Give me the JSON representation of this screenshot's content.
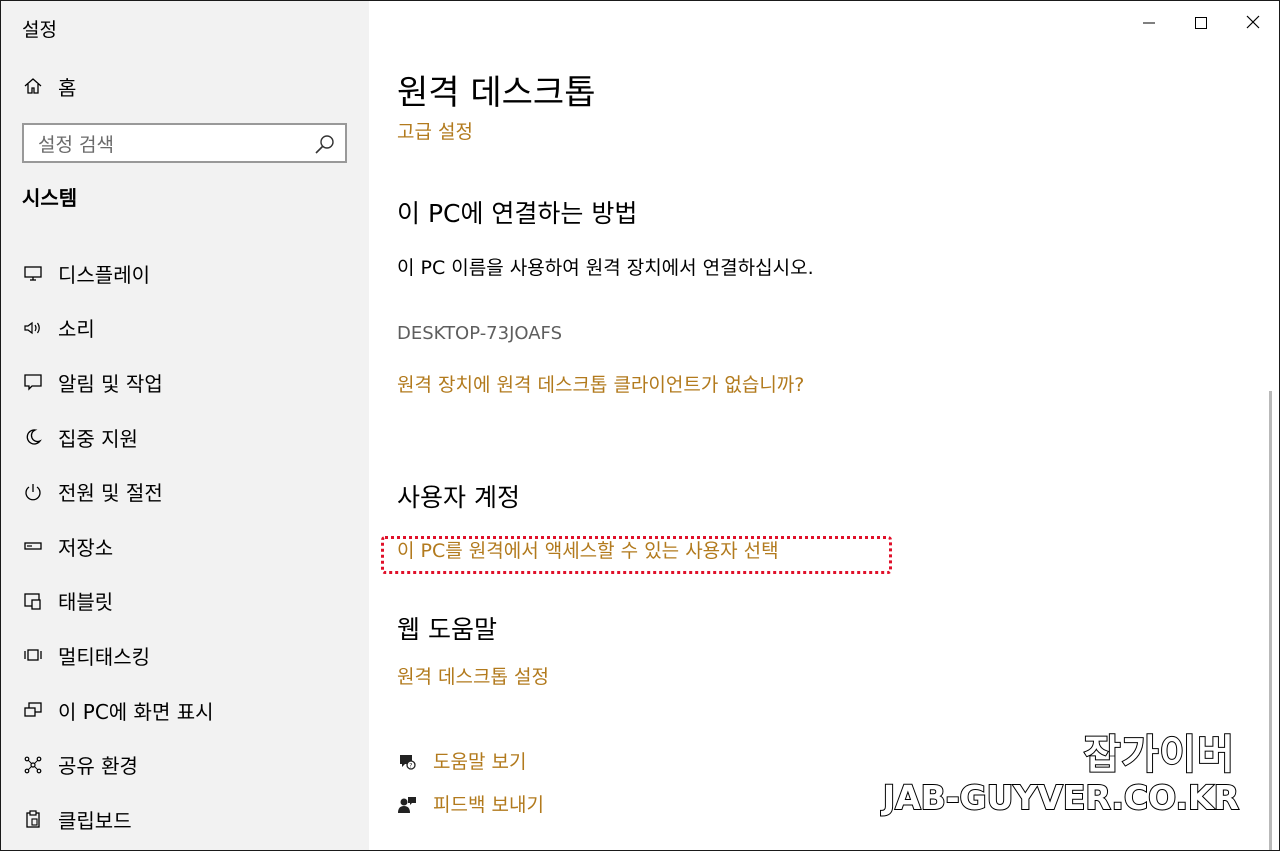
{
  "app": {
    "title": "설정"
  },
  "window_controls": {
    "minimize_icon": "minimize-icon",
    "maximize_icon": "maximize-icon",
    "close_icon": "close-icon"
  },
  "sidebar": {
    "home_label": "홈",
    "search_placeholder": "설정 검색",
    "section_title": "시스템",
    "items": [
      {
        "label": "디스플레이",
        "icon": "monitor-icon"
      },
      {
        "label": "소리",
        "icon": "speaker-icon"
      },
      {
        "label": "알림 및 작업",
        "icon": "notification-icon"
      },
      {
        "label": "집중 지원",
        "icon": "moon-icon"
      },
      {
        "label": "전원 및 절전",
        "icon": "power-icon"
      },
      {
        "label": "저장소",
        "icon": "storage-icon"
      },
      {
        "label": "태블릿",
        "icon": "tablet-icon"
      },
      {
        "label": "멀티태스킹",
        "icon": "multitasking-icon"
      },
      {
        "label": "이 PC에 화면 표시",
        "icon": "project-icon"
      },
      {
        "label": "공유 환경",
        "icon": "share-icon"
      },
      {
        "label": "클립보드",
        "icon": "clipboard-icon"
      }
    ]
  },
  "main": {
    "title": "원격 데스크톱",
    "advanced_link": "고급 설정",
    "connect_heading": "이 PC에 연결하는 방법",
    "connect_desc": "이 PC 이름을 사용하여 원격 장치에서 연결하십시오.",
    "pc_name": "DESKTOP-73JOAFS",
    "no_client_link": "원격 장치에 원격 데스크톱 클라이언트가 없습니까?",
    "accounts_heading": "사용자 계정",
    "select_users_link": "이 PC를 원격에서 액세스할 수 있는 사용자 선택",
    "help_heading": "웹 도움말",
    "rd_settings_link": "원격 데스크톱 설정",
    "get_help_link": "도움말 보기",
    "feedback_link": "피드백 보내기"
  },
  "watermark": {
    "line1": "잡가이버",
    "line2": "JAB-GUYVER.CO.KR"
  },
  "colors": {
    "accent_link": "#b27a1d",
    "sidebar_bg": "#f2f2f2",
    "highlight_border": "#e0102a"
  }
}
